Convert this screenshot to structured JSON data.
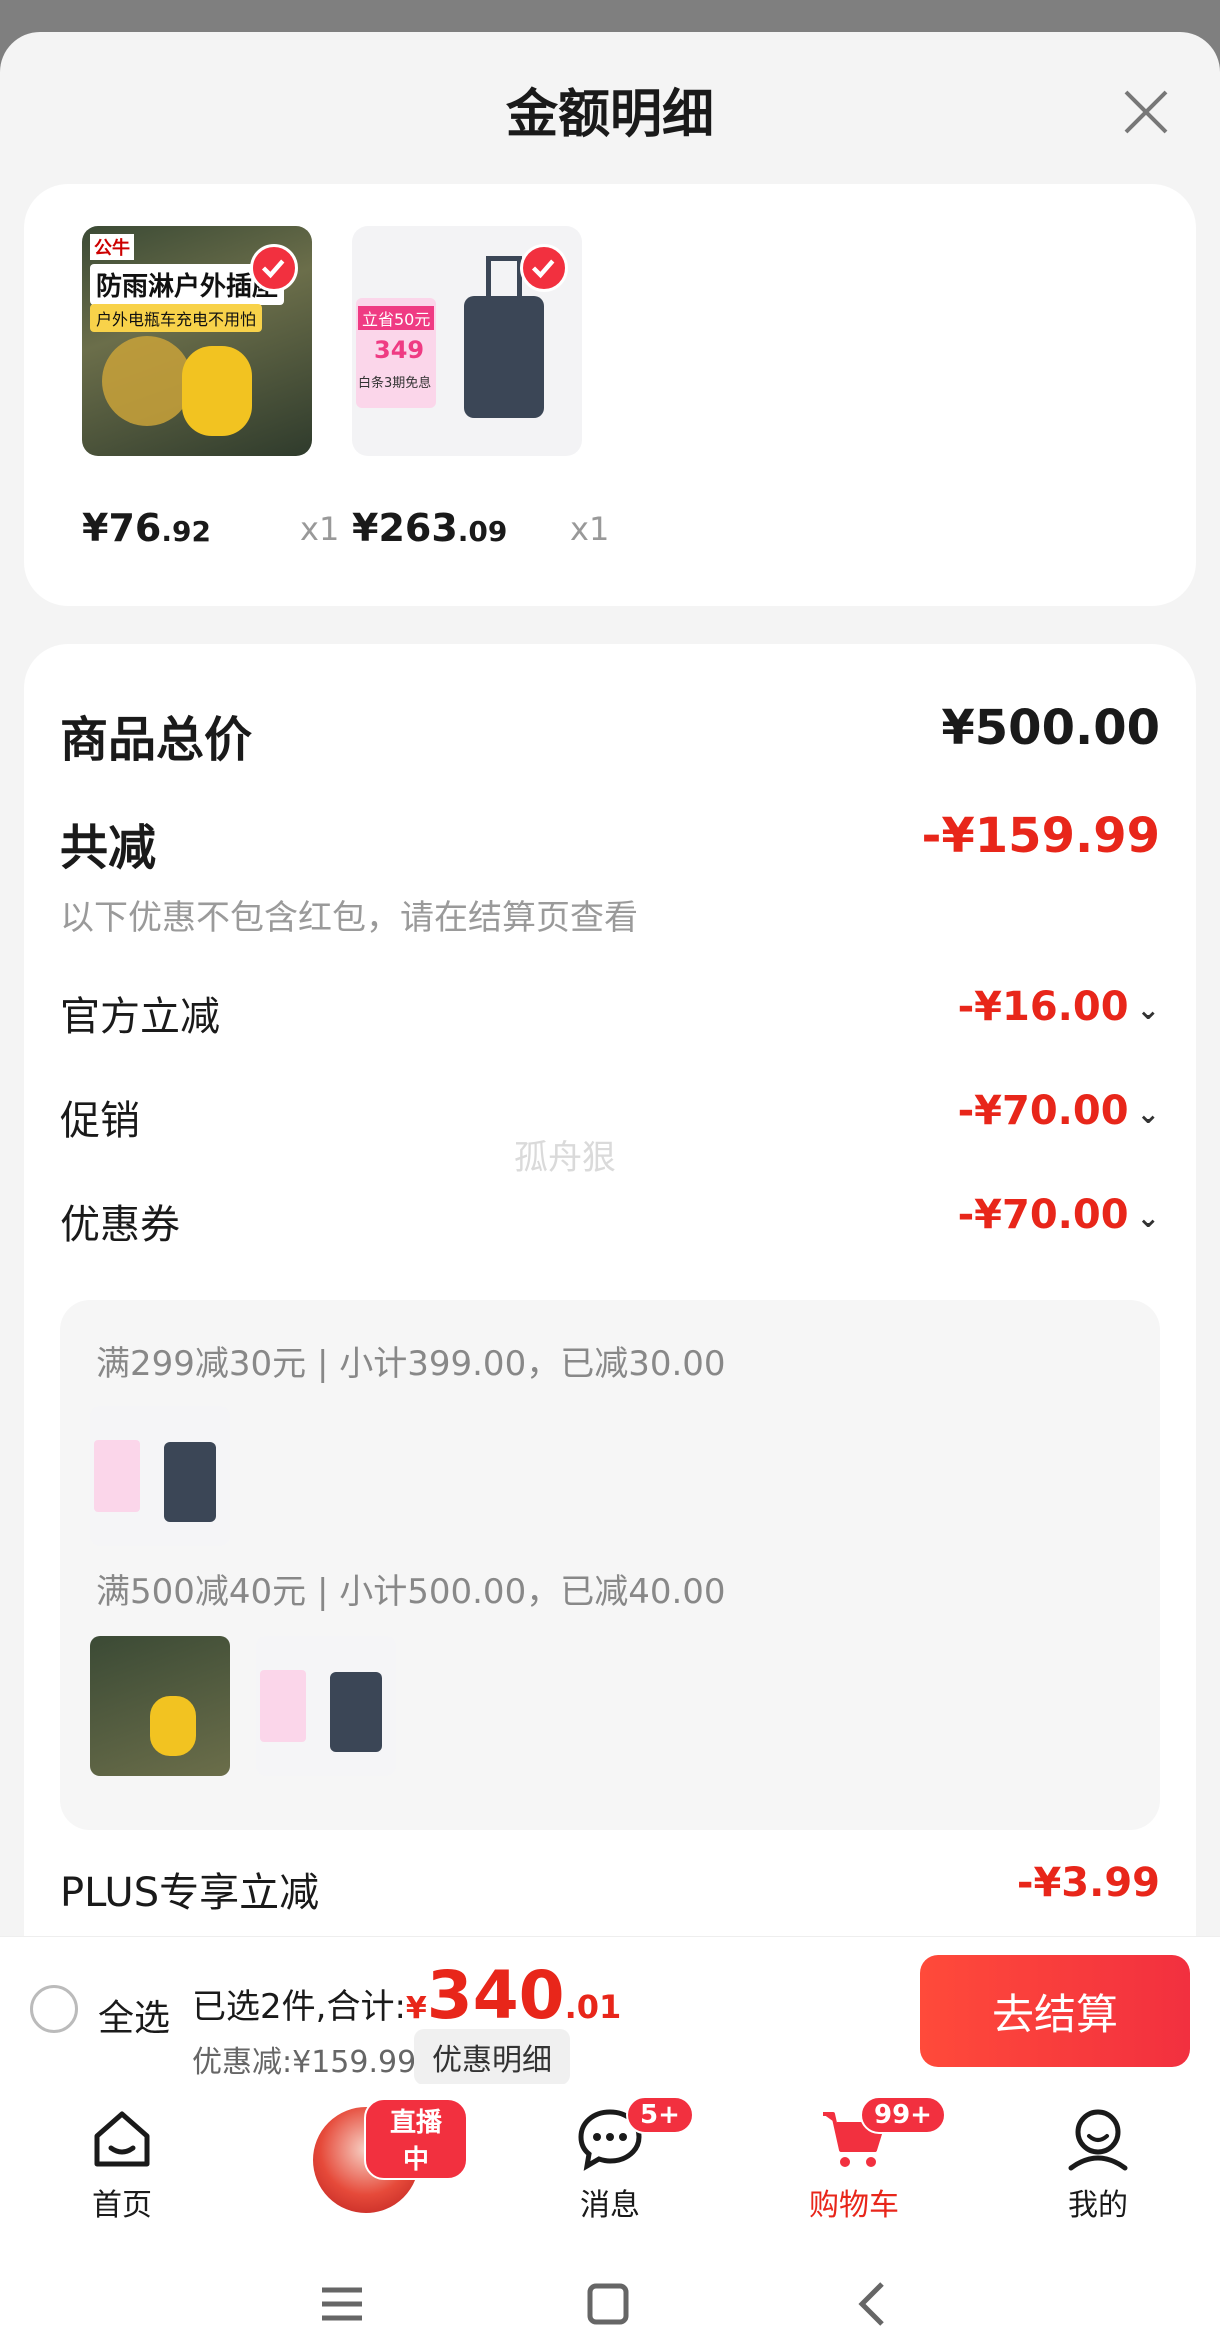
{
  "sheet": {
    "title": "金额明细",
    "close_icon": "close-icon"
  },
  "products": [
    {
      "image_label_title": "防雨淋户外插座",
      "image_label_sub": "户外电瓶车充电不用怕",
      "brand": "公牛",
      "price_int": "¥76",
      "price_dec": ".92",
      "qty": "x1",
      "selected": true
    },
    {
      "image_label_title": "立省50元",
      "image_label_price": "349",
      "image_label_sub": "白条3期免息",
      "price_int": "¥263",
      "price_dec": ".09",
      "qty": "x1",
      "selected": true
    }
  ],
  "details": {
    "total_label": "商品总价",
    "total_value": "¥500.00",
    "reduce_label": "共减",
    "reduce_value": "-¥159.99",
    "reduce_note": "以下优惠不包含红包，请在结算页查看",
    "official_label": "官方立减",
    "official_value": "-¥16.00",
    "promo_label": "促销",
    "promo_value": "-¥70.00",
    "coupon_label": "优惠券",
    "coupon_value": "-¥70.00",
    "coupon_rules": [
      "满299减30元 | 小计399.00，已减30.00",
      "满500减40元 | 小计500.00，已减40.00"
    ],
    "plus_label": "PLUS专享立减",
    "plus_value": "-¥3.99"
  },
  "watermark": "孤舟狠",
  "checkout": {
    "select_all": "全选",
    "selected_text": "已选2件,合计:",
    "total_yen": "¥",
    "total_int": "340",
    "total_dec": ".01",
    "discount_text": "优惠减:¥159.99",
    "detail_link": "优惠明细",
    "button": "去结算"
  },
  "tabs": [
    {
      "label": "首页",
      "icon": "home-icon"
    },
    {
      "label": "",
      "icon": "live-avatar",
      "badge": "直播中"
    },
    {
      "label": "消息",
      "icon": "message-icon",
      "badge": "5+"
    },
    {
      "label": "购物车",
      "icon": "cart-icon",
      "badge": "99+",
      "active": true
    },
    {
      "label": "我的",
      "icon": "profile-icon"
    }
  ],
  "colors": {
    "accent_red": "#e8261a",
    "button_red": "#f2303f"
  }
}
